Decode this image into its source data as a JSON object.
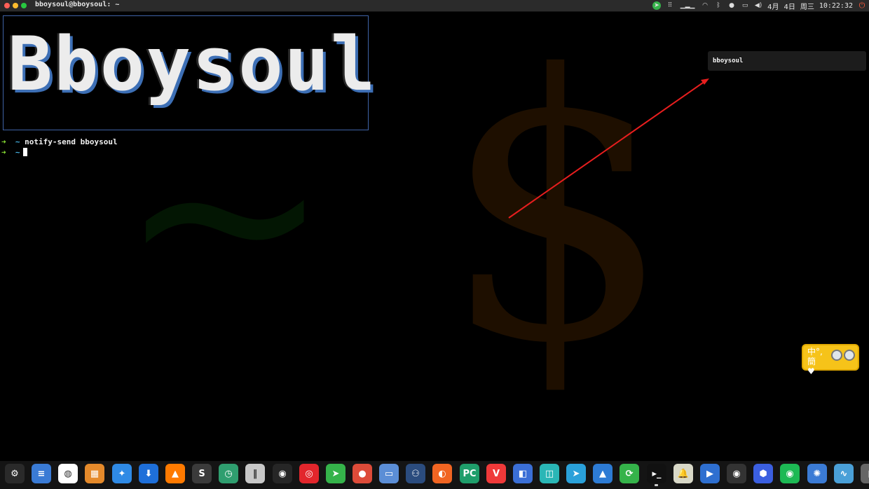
{
  "window": {
    "title": "bboysoul@bboysoul: ~"
  },
  "tray": {
    "date_month": "4月",
    "date_day": "4日",
    "weekday": "周三",
    "time": "10:22:32"
  },
  "banner": {
    "text": "Bboysoul"
  },
  "terminal": {
    "prompt_arrow": "➜",
    "prompt_dir": "~",
    "command": "notify-send bboysoul"
  },
  "notification": {
    "body": "bboysoul"
  },
  "ime": {
    "label": "中°,簡♥"
  },
  "wallpaper": {
    "dollar": "$",
    "tilde": "~"
  },
  "colors": {
    "accent": "#3d6fb5",
    "prompt": "#8ae234",
    "annotation": "#e81e1e",
    "ime_bg": "#f6c319"
  },
  "dock": {
    "items": [
      {
        "icon": "settings-icon",
        "glyph": "⚙",
        "bg": "#2a2a2a"
      },
      {
        "icon": "text-editor-icon",
        "glyph": "≡",
        "bg": "#3a7bd5"
      },
      {
        "icon": "wechat-icon",
        "glyph": "◍",
        "bg": "#ffffff"
      },
      {
        "icon": "image-viewer-icon",
        "glyph": "▦",
        "bg": "#e58a2b"
      },
      {
        "icon": "feishu-icon",
        "glyph": "✦",
        "bg": "#2f8ae5"
      },
      {
        "icon": "downloader-icon",
        "glyph": "⬇",
        "bg": "#1e6fd9"
      },
      {
        "icon": "vlc-icon",
        "glyph": "▲",
        "bg": "#ff7a00"
      },
      {
        "icon": "sublime-icon",
        "glyph": "S",
        "bg": "#3b3b3b"
      },
      {
        "icon": "disk-icon",
        "glyph": "◷",
        "bg": "#2f9e6f"
      },
      {
        "icon": "mixer-icon",
        "glyph": "‖",
        "bg": "#c8c8c8"
      },
      {
        "icon": "obs-icon",
        "glyph": "◉",
        "bg": "#262626"
      },
      {
        "icon": "netease-music-icon",
        "glyph": "◎",
        "bg": "#e2262c"
      },
      {
        "icon": "telegram-desktop-icon",
        "glyph": "➤",
        "bg": "#35b34a"
      },
      {
        "icon": "chrome-icon",
        "glyph": "●",
        "bg": "#dd4b39"
      },
      {
        "icon": "files-icon",
        "glyph": "▭",
        "bg": "#5b8ed6"
      },
      {
        "icon": "steam-icon",
        "glyph": "⚇",
        "bg": "#2b4c7e"
      },
      {
        "icon": "firefox-icon",
        "glyph": "◐",
        "bg": "#f16522"
      },
      {
        "icon": "pycharm-icon",
        "glyph": "PC",
        "bg": "#1f9e6b"
      },
      {
        "icon": "vivaldi-icon",
        "glyph": "V",
        "bg": "#ef3939"
      },
      {
        "icon": "wps-icon",
        "glyph": "◧",
        "bg": "#3b6fd6"
      },
      {
        "icon": "screenshot-icon",
        "glyph": "◫",
        "bg": "#2ab6b6"
      },
      {
        "icon": "telegram-icon",
        "glyph": "➤",
        "bg": "#2aa1da"
      },
      {
        "icon": "mountain-app-icon",
        "glyph": "▲",
        "bg": "#2d7bd4"
      },
      {
        "icon": "sync-icon",
        "glyph": "⟳",
        "bg": "#35b34a"
      },
      {
        "icon": "terminal-icon",
        "glyph": "▸_",
        "bg": "#111111"
      },
      {
        "icon": "notification-bell-icon",
        "glyph": "🔔",
        "bg": "#d8d8c8"
      },
      {
        "icon": "media-player-icon",
        "glyph": "▶",
        "bg": "#2e6fd0"
      },
      {
        "icon": "disc-icon",
        "glyph": "◉",
        "bg": "#333333"
      },
      {
        "icon": "hex-app-icon",
        "glyph": "⬢",
        "bg": "#3b5fe0"
      },
      {
        "icon": "spotify-icon",
        "glyph": "◉",
        "bg": "#1db954"
      },
      {
        "icon": "pinwheel-icon",
        "glyph": "✺",
        "bg": "#3b7bd5"
      },
      {
        "icon": "activity-monitor-icon",
        "glyph": "∿",
        "bg": "#4aa0d8"
      },
      {
        "icon": "trash-icon",
        "glyph": "▯",
        "bg": "#666666"
      }
    ]
  }
}
